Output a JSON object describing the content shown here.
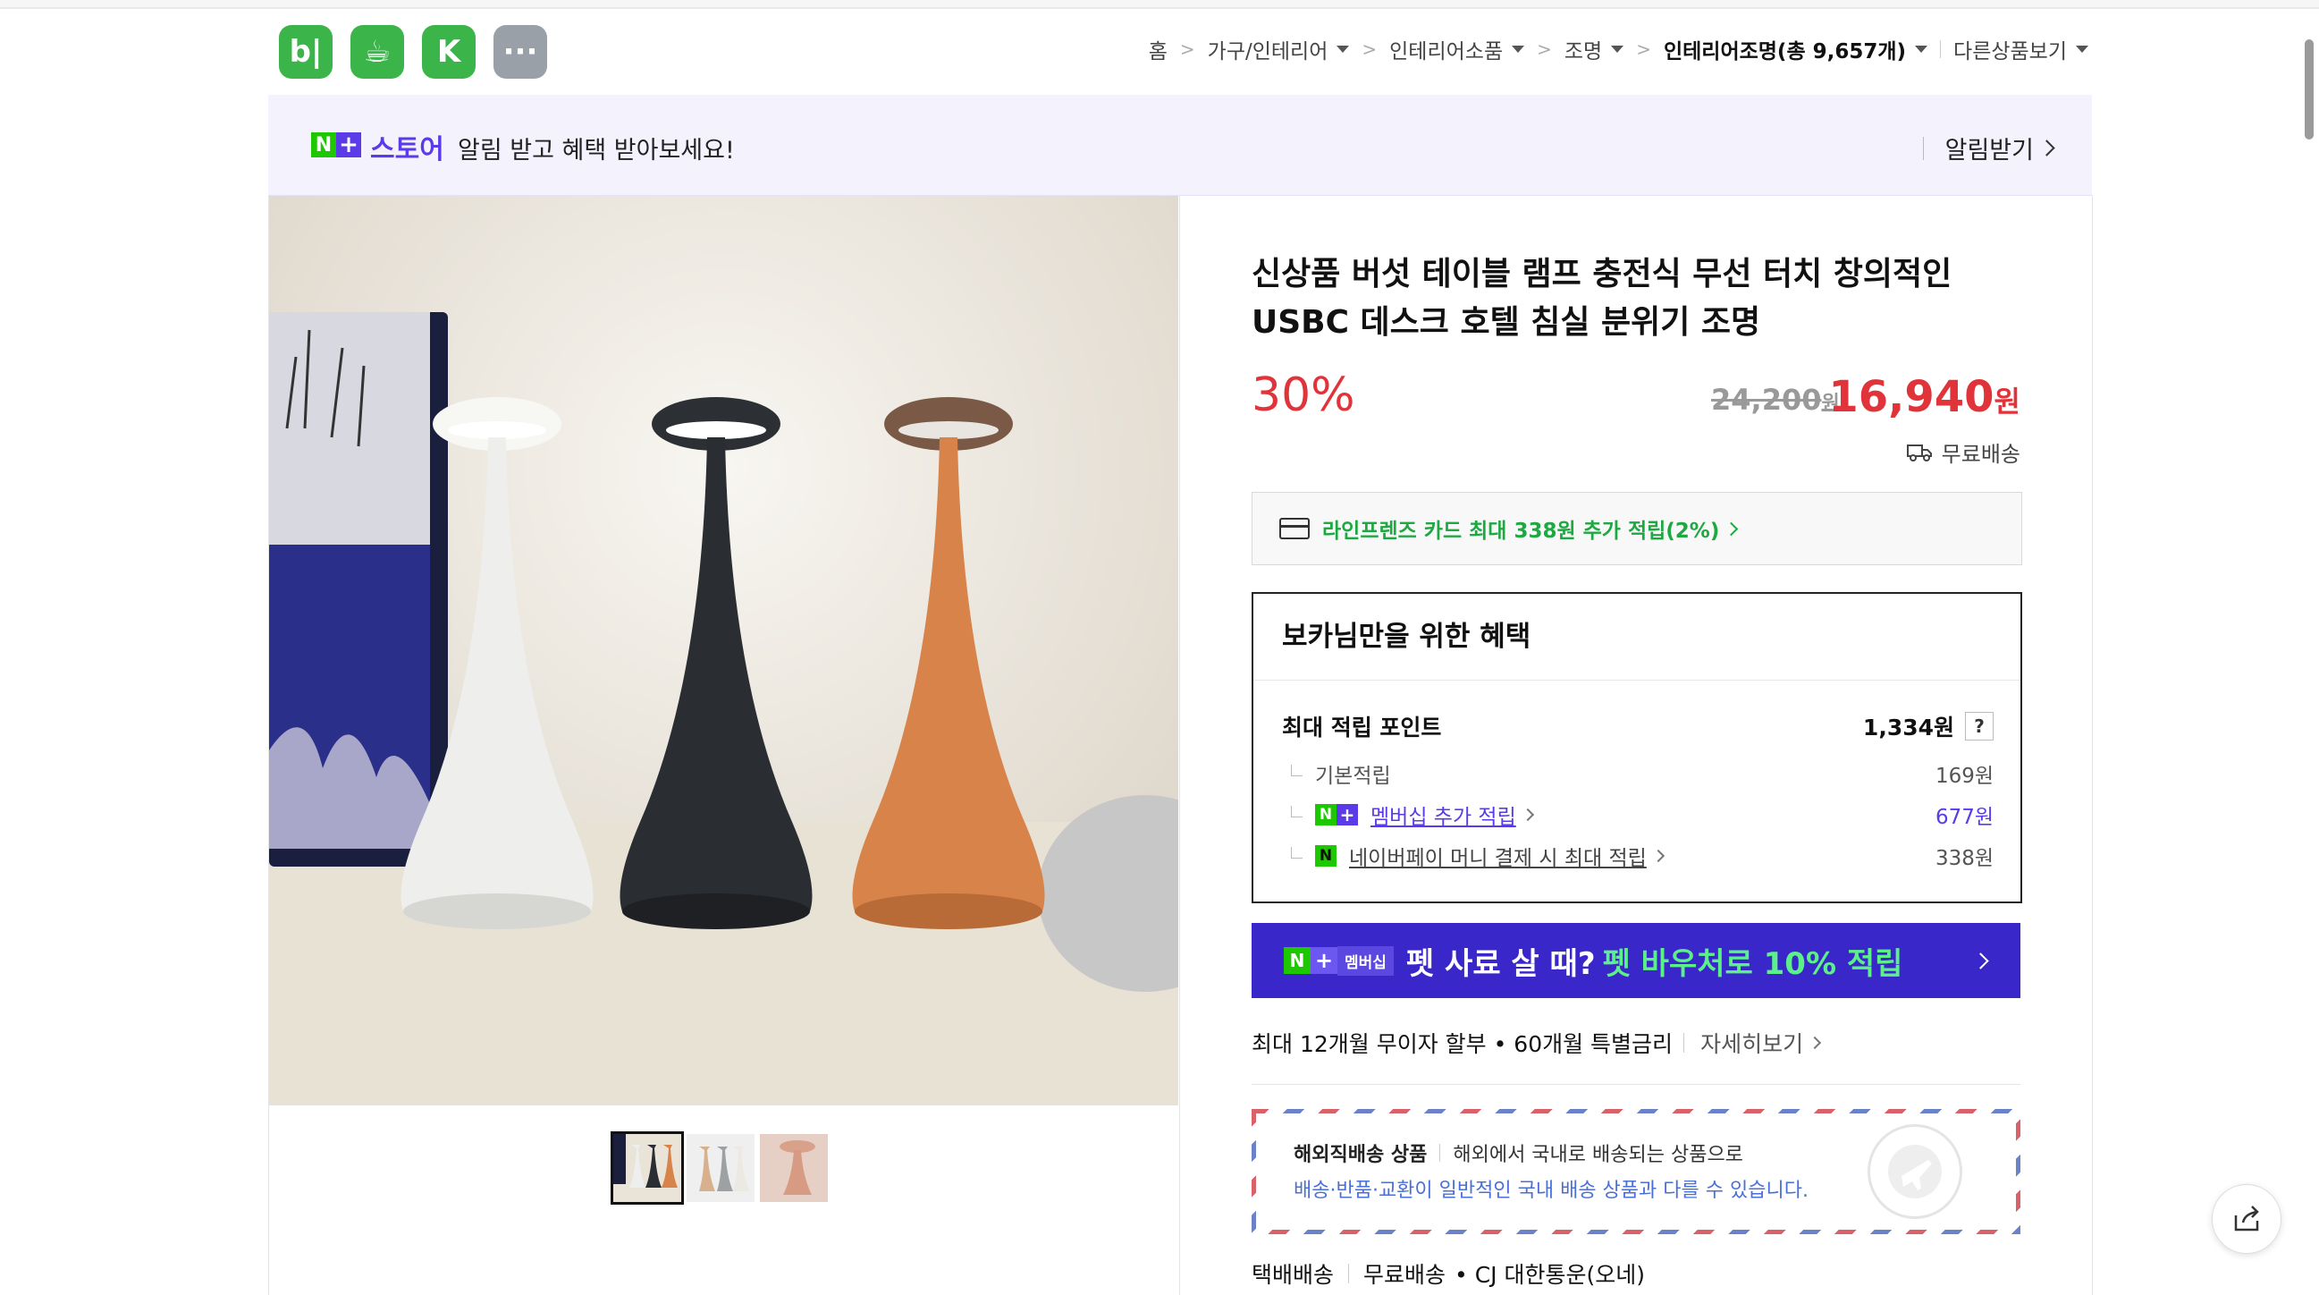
{
  "apps": [
    {
      "name": "blog-app",
      "label": "b|"
    },
    {
      "name": "cafe-app",
      "label": "☕"
    },
    {
      "name": "bookmark-app",
      "label": "K"
    },
    {
      "name": "more-apps",
      "label": "···"
    }
  ],
  "breadcrumb": {
    "home": "홈",
    "c1": "가구/인테리어",
    "c2": "인테리어소품",
    "c3": "조명",
    "c4": "인테리어조명(총 9,657개)",
    "other": "다른상품보기"
  },
  "banner": {
    "store": "스토어",
    "message": "알림 받고 혜택 받아보세요!",
    "notify": "알림받기"
  },
  "product": {
    "title": "신상품 버섯 테이블 램프 충전식 무선 터치 창의적인 USBC 데스크 호텔 침실 분위기 조명",
    "discount": "30%",
    "original_price": "24,200",
    "price": "16,940",
    "won": "원",
    "shipping": "무료배송"
  },
  "card_offer": "라인프렌즈 카드 최대 338원 추가 적립(2%)",
  "benefits": {
    "heading": "보카님만을 위한 혜택",
    "max_label": "최대 적립 포인트",
    "max_value": "1,334원",
    "help": "?",
    "basic_label": "기본적립",
    "basic_value": "169원",
    "membership_label": "멤버십 추가 적립",
    "membership_value": "677원",
    "pay_label": "네이버페이 머니 결제 시 최대 적립",
    "pay_value": "338원"
  },
  "promo": {
    "badge": "멤버십",
    "text1": "펫 사료 살 때?",
    "text2": "펫 바우처로 10% 적립"
  },
  "installment": {
    "text": "최대 12개월 무이자 할부 • 60개월 특별금리",
    "more": "자세히보기"
  },
  "overseas": {
    "title": "해외직배송 상품",
    "desc": "해외에서 국내로 배송되는 상품으로",
    "note": "배송·반품·교환이 일반적인 국내 배송 상품과 다를 수 있습니다."
  },
  "delivery": {
    "method": "택배배송",
    "fee": "무료배송",
    "carrier": "• CJ 대한통운(오네)"
  },
  "colors": {
    "naver_green": "#1ec800",
    "plus_purple": "#5b3be8",
    "price_red": "#e0333a",
    "promo_bg": "#3a27c9"
  }
}
